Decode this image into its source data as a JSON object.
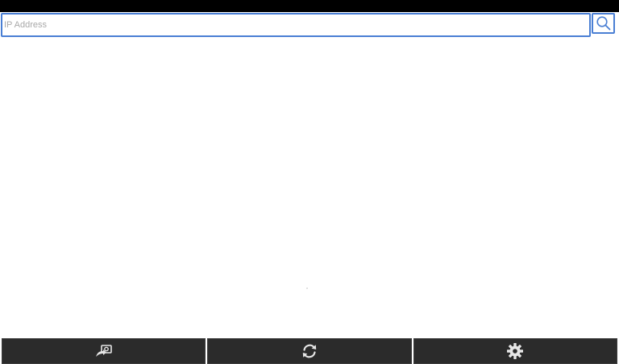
{
  "search": {
    "placeholder": "IP Address",
    "value": "",
    "button_icon": "search-icon"
  },
  "toolbar": {
    "buttons": [
      {
        "id": "cast",
        "icon": "cast-screen-icon"
      },
      {
        "id": "refresh",
        "icon": "refresh-icon"
      },
      {
        "id": "settings",
        "icon": "settings-gear-icon"
      }
    ]
  },
  "colors": {
    "accent": "#4a7fd4",
    "status_bar": "#000000",
    "toolbar_bg": "#2b2b2b",
    "toolbar_icon": "#e6e6e6",
    "placeholder": "#a8a8a8"
  }
}
